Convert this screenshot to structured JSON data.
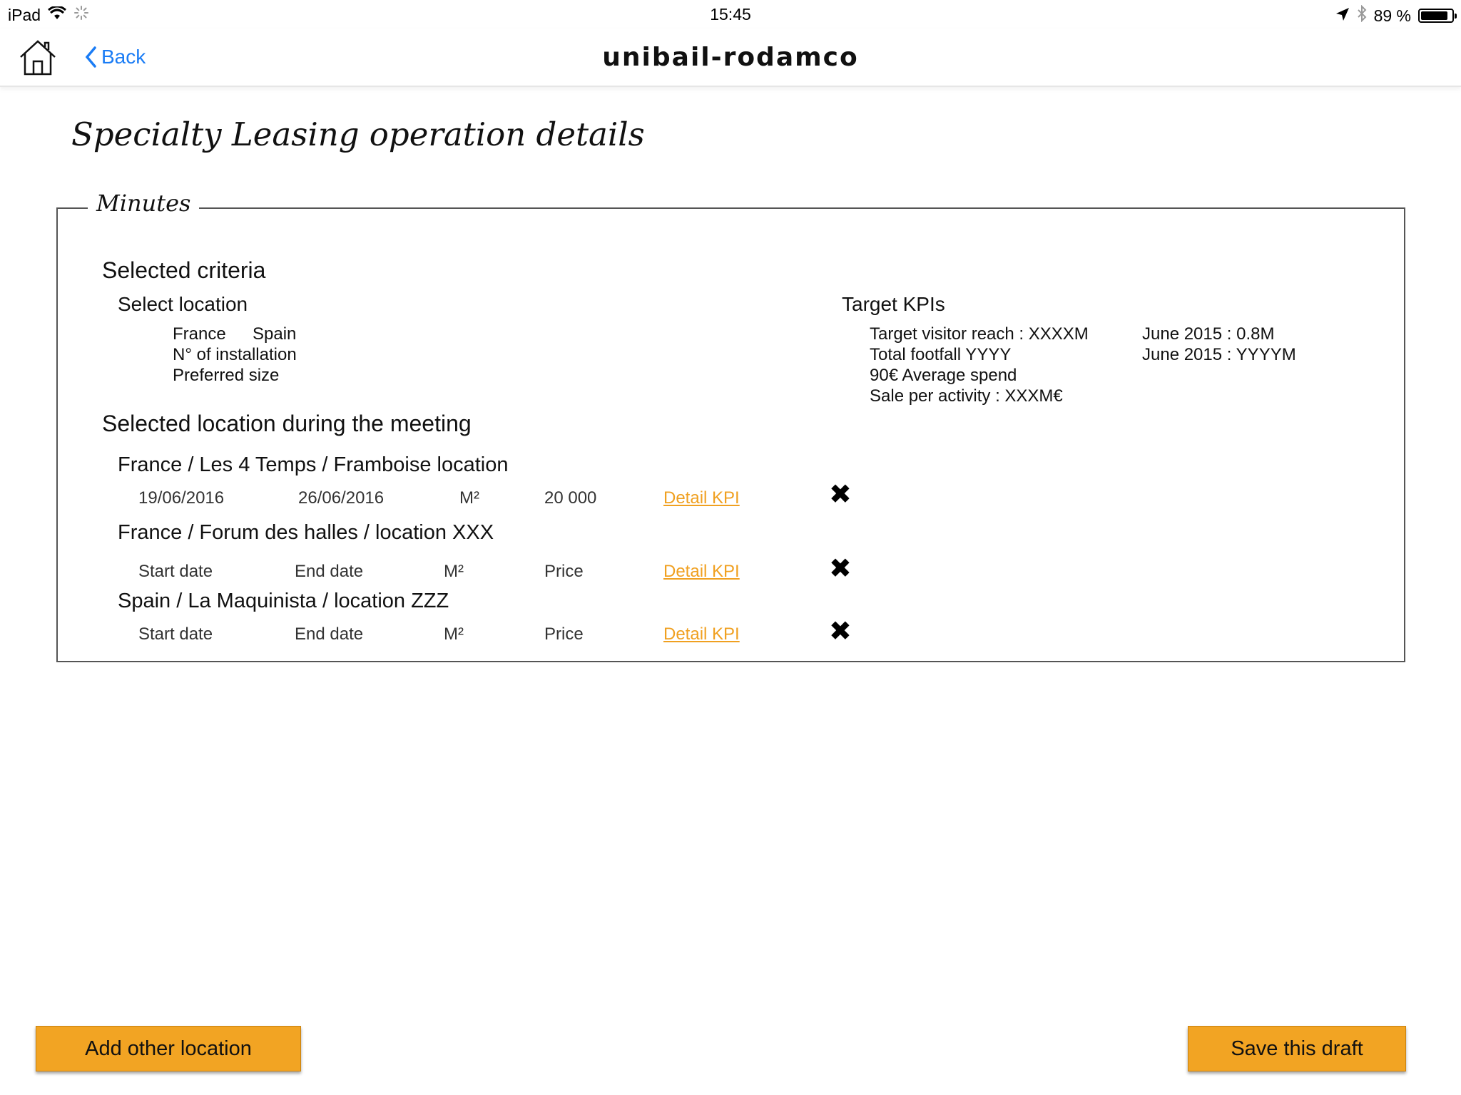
{
  "status_bar": {
    "device": "iPad",
    "time": "15:45",
    "battery_text": "89 %",
    "battery_level": 0.89
  },
  "nav": {
    "back_label": "Back",
    "title": "unibail-rodamco"
  },
  "page": {
    "title": "Specialty Leasing operation details"
  },
  "minutes": {
    "legend": "Minutes",
    "selected_criteria": {
      "heading": "Selected criteria",
      "select_location": {
        "heading": "Select location",
        "countries": [
          "France",
          "Spain"
        ],
        "installation": "N° of installation",
        "preferred_size": "Preferred size"
      },
      "target_kpis": {
        "heading": "Target KPIs",
        "items": [
          "Target visitor reach : XXXXM",
          "Total footfall YYYY",
          "90€ Average spend",
          "Sale per activity : XXXM€"
        ],
        "reference": [
          "June 2015 : 0.8M",
          "June 2015 : YYYYM"
        ]
      }
    },
    "selected_locations": {
      "heading": "Selected location during the meeting",
      "locations": [
        {
          "title": "France / Les 4 Temps / Framboise location",
          "start": "19/06/2016",
          "end": "26/06/2016",
          "area": "M²",
          "price": "20 000",
          "detail": "Detail KPI"
        },
        {
          "title": "France / Forum des halles / location XXX",
          "start": "Start date",
          "end": "End date",
          "area": "M²",
          "price": "Price",
          "detail": "Detail KPI"
        },
        {
          "title": "Spain / La Maquinista / location ZZZ",
          "start": "Start date",
          "end": "End date",
          "area": "M²",
          "price": "Price",
          "detail": "Detail KPI"
        }
      ]
    }
  },
  "footer": {
    "add_location": "Add other location",
    "save_draft": "Save this draft"
  },
  "colors": {
    "accent": "#f2a423",
    "link": "#f0a020",
    "back": "#1a7cf5"
  }
}
